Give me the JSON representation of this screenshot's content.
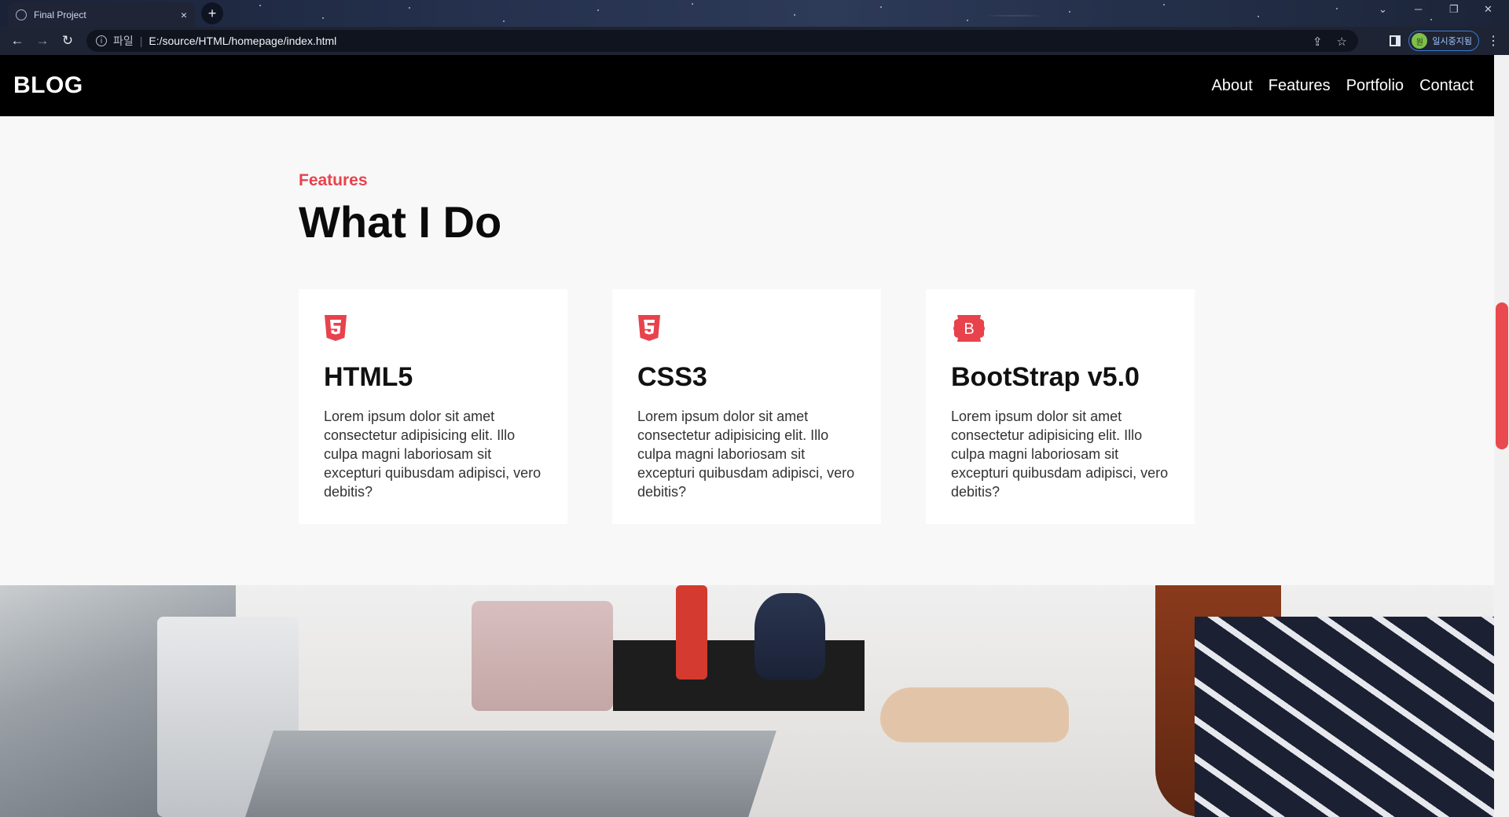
{
  "browser": {
    "tab_title": "Final Project",
    "tab_close": "×",
    "new_tab": "+",
    "omnibox": {
      "scheme_label": "파일",
      "separator": "|",
      "url": "E:/source/HTML/homepage/index.html"
    },
    "profile_label": "일시중지됨",
    "profile_avatar": "원"
  },
  "site": {
    "brand": "BLOG",
    "nav": [
      "About",
      "Features",
      "Portfolio",
      "Contact"
    ]
  },
  "features": {
    "eyebrow": "Features",
    "headline": "What I Do",
    "cards": [
      {
        "icon": "html5-icon",
        "title": "HTML5",
        "text": "Lorem ipsum dolor sit amet consectetur adipisicing elit. Illo culpa magni laboriosam sit excepturi quibusdam adipisci, vero debitis?"
      },
      {
        "icon": "css3-icon",
        "title": "CSS3",
        "text": "Lorem ipsum dolor sit amet consectetur adipisicing elit. Illo culpa magni laboriosam sit excepturi quibusdam adipisci, vero debitis?"
      },
      {
        "icon": "bootstrap-icon",
        "title": "BootStrap v5.0",
        "text": "Lorem ipsum dolor sit amet consectetur adipisicing elit. Illo culpa magni laboriosam sit excepturi quibusdam adipisci, vero debitis?"
      }
    ]
  },
  "colors": {
    "accent": "#e8424c",
    "nav_bg": "#000000",
    "page_bg": "#f8f8f8",
    "card_bg": "#ffffff"
  },
  "scrollbar": {
    "position_fraction": 0.33
  }
}
